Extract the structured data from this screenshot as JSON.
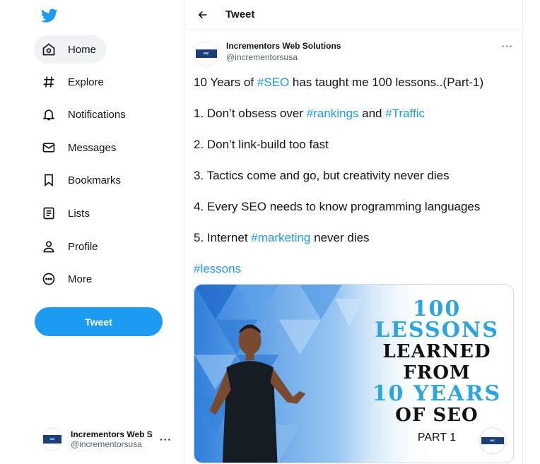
{
  "sidebar": {
    "nav": [
      {
        "label": "Home",
        "icon": "home-icon"
      },
      {
        "label": "Explore",
        "icon": "hashtag-icon"
      },
      {
        "label": "Notifications",
        "icon": "bell-icon"
      },
      {
        "label": "Messages",
        "icon": "envelope-icon"
      },
      {
        "label": "Bookmarks",
        "icon": "bookmark-icon"
      },
      {
        "label": "Lists",
        "icon": "list-icon"
      },
      {
        "label": "Profile",
        "icon": "person-icon"
      },
      {
        "label": "More",
        "icon": "more-circle-icon"
      }
    ],
    "tweet_button": "Tweet",
    "account": {
      "name": "Incrementors Web S",
      "handle": "@incrementorsusa",
      "more": "···"
    }
  },
  "header": {
    "title": "Tweet"
  },
  "tweet": {
    "author_name": "Incrementors Web Solutions",
    "author_handle": "@incrementorsusa",
    "more": "···",
    "lines": {
      "l1_pre": "10 Years of ",
      "l1_tag": "#SEO",
      "l1_post": " has taught me 100 lessons..(Part-1)",
      "l2_pre": "1. Don’t obsess over ",
      "l2_tag1": "#rankings",
      "l2_mid": " and ",
      "l2_tag2": "#Traffic",
      "l3": "2. Don’t link-build too fast",
      "l4": "3. Tactics come and go, but creativity never dies",
      "l5": "4. Every SEO needs to know programming languages",
      "l6_pre": "5. Internet ",
      "l6_tag": "#marketing",
      "l6_post": " never dies",
      "l7_tag": "#lessons"
    },
    "media": {
      "line1": "100",
      "line2": "LESSONS",
      "line3": "LEARNED",
      "line4": "FROM",
      "line5": "10 YEARS",
      "line6": "OF SEO",
      "line7": "PART 1"
    }
  },
  "colors": {
    "accent": "#1d9bf0",
    "text": "#0f1419",
    "muted": "#536471"
  }
}
